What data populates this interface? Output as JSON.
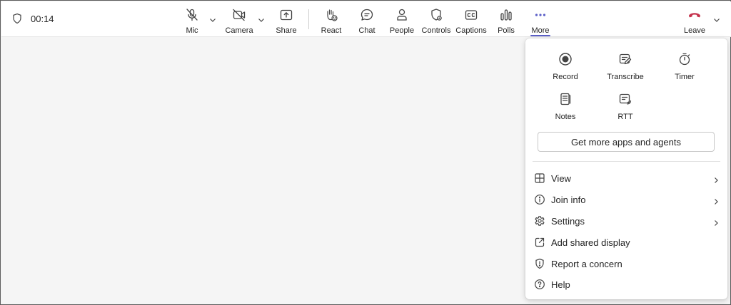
{
  "meeting": {
    "elapsed": "00:14"
  },
  "toolbar": {
    "mic_label": "Mic",
    "camera_label": "Camera",
    "share_label": "Share",
    "react_label": "React",
    "chat_label": "Chat",
    "people_label": "People",
    "controls_label": "Controls",
    "captions_label": "Captions",
    "polls_label": "Polls",
    "more_label": "More",
    "leave_label": "Leave"
  },
  "more_panel": {
    "apps": [
      {
        "label": "Record",
        "icon": "record-icon"
      },
      {
        "label": "Transcribe",
        "icon": "transcribe-icon"
      },
      {
        "label": "Timer",
        "icon": "timer-icon"
      },
      {
        "label": "Notes",
        "icon": "notes-icon"
      },
      {
        "label": "RTT",
        "icon": "rtt-icon"
      }
    ],
    "get_apps_label": "Get more apps and agents",
    "menu": [
      {
        "label": "View",
        "icon": "grid-icon",
        "has_submenu": true
      },
      {
        "label": "Join info",
        "icon": "info-icon",
        "has_submenu": true
      },
      {
        "label": "Settings",
        "icon": "gear-icon",
        "has_submenu": true
      },
      {
        "label": "Add shared display",
        "icon": "external-link-icon",
        "has_submenu": false
      },
      {
        "label": "Report a concern",
        "icon": "shield-icon",
        "has_submenu": false
      },
      {
        "label": "Help",
        "icon": "help-icon",
        "has_submenu": false
      }
    ]
  },
  "colors": {
    "accent": "#5b5fc7",
    "leave_red": "#c4314b",
    "icon": "#424242"
  }
}
